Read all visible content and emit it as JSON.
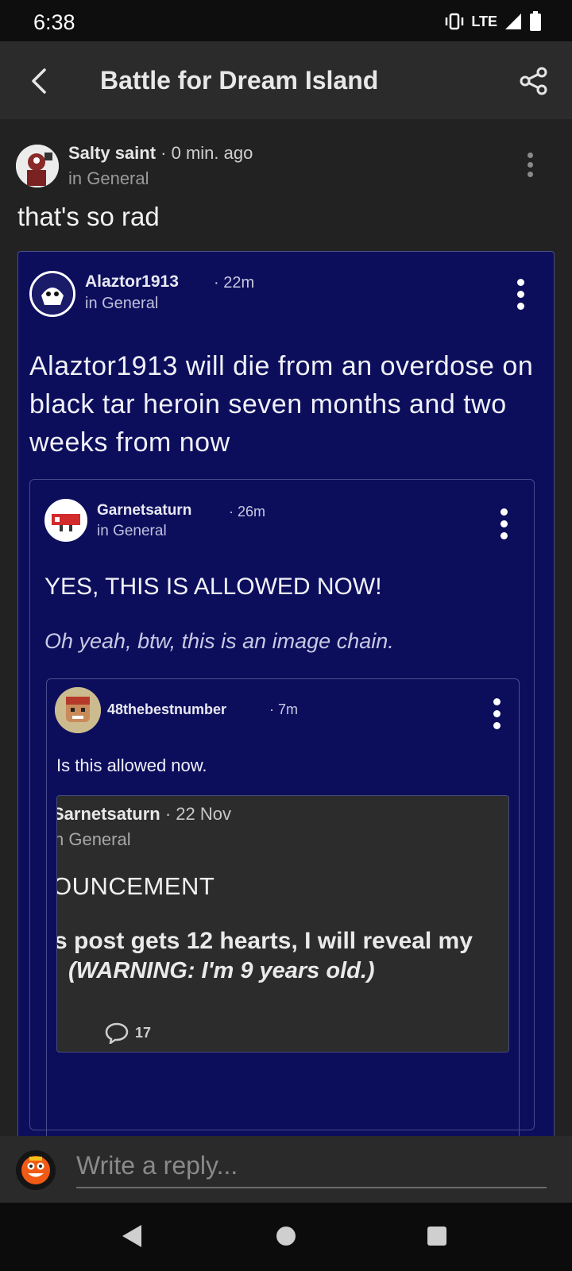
{
  "status_bar": {
    "time": "6:38",
    "network": "LTE"
  },
  "app_bar": {
    "title": "Battle for Dream Island"
  },
  "post": {
    "author": "Salty saint",
    "time": "· 0 min. ago",
    "community": "in General",
    "text": "that's so rad"
  },
  "embedded": {
    "alaztor": {
      "author": "Alaztor1913",
      "time": "· 22m",
      "community": "in General",
      "text": "Alaztor1913 will die from an overdose on black tar heroin seven months and two weeks from now"
    },
    "garnet": {
      "author": "Garnetsaturn",
      "time": "· 26m",
      "community": "in General",
      "headline": "YES, THIS IS ALLOWED NOW!",
      "subtext": "Oh yeah, btw, this is an image chain."
    },
    "n48": {
      "author": "48thebestnumber",
      "time": "· 7m",
      "text": "Is this allowed now."
    },
    "nested": {
      "author": "Sarnetsaturn",
      "time": "· 22 Nov",
      "community": "n General",
      "title": "OUNCEMENT",
      "body": "s post gets 12 hearts, I will reveal my",
      "warning": "(WARNING: I'm 9 years old.)",
      "comment_count": "17"
    }
  },
  "reply": {
    "placeholder": "Write a reply..."
  },
  "icons": {
    "back": "back-arrow-icon",
    "share": "share-icon",
    "more": "more-vertical-icon",
    "comment": "comment-bubble-icon"
  },
  "colors": {
    "app_bar": "#2b2b2b",
    "embedded_bg": "#0c0e5c",
    "nested_bg": "#2c2c2c"
  }
}
